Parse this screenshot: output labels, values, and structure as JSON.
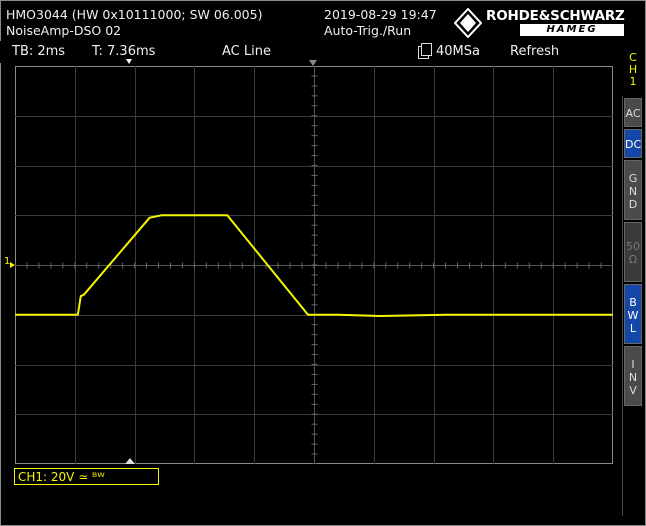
{
  "header": {
    "device": "HMO3044 (HW 0x10111000; SW 06.005)",
    "setup_name": "NoiseAmp-DSO 02",
    "datetime": "2019-08-29 19:47",
    "trigger_status": "Auto-Trig./Run",
    "brand_top": "ROHDE&SCHWARZ",
    "brand_bottom": "HAMEG"
  },
  "info_bar": {
    "timebase": "TB: 2ms",
    "trigger_time": "T: 7.36ms",
    "trigger_source": "AC Line",
    "sample_rate": "40MSa",
    "acquisition_mode": "Refresh"
  },
  "channel_label": "CH1: 20V ≃ ᴮᵂ",
  "side_menu": {
    "title": "C\nH\n1",
    "buttons": [
      "AC",
      "DC",
      "G\nN\nD",
      "50\nΩ",
      "B\nW\nL",
      "I\nN\nV"
    ],
    "active": [
      "DC",
      "B\nW\nL"
    ]
  },
  "ground_marker": "1",
  "colors": {
    "trace": "#f5f500",
    "grid": "#3c3c3c",
    "grid_border": "#8a8a8a",
    "active_button": "#1448a8"
  },
  "chart_data": {
    "type": "line",
    "title": "",
    "xlabel": "",
    "ylabel": "",
    "x_unit": "ms",
    "y_unit": "V",
    "xlim": [
      0,
      20
    ],
    "ylim": [
      -80,
      80
    ],
    "grid": true,
    "series": [
      {
        "x": [
          0,
          2.1,
          2.2,
          2.3,
          4.5,
          4.9,
          7.1,
          7.2,
          9.8,
          10.8,
          12.2,
          14.4,
          20
        ],
        "y": [
          -20,
          -20,
          -12.5,
          -12,
          19,
          20,
          20,
          18.5,
          -20,
          -20,
          -20.5,
          -20,
          -20
        ]
      }
    ]
  }
}
